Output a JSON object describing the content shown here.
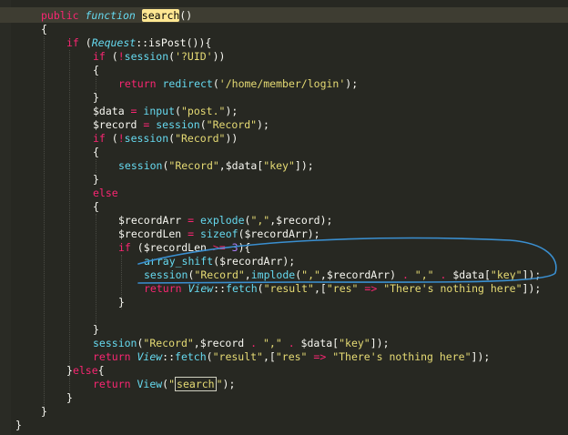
{
  "editor": {
    "lines": [
      [
        [
          "kw",
          "public "
        ],
        [
          "fn",
          "function "
        ],
        [
          "hl",
          "search"
        ],
        [
          "pl",
          "()"
        ]
      ],
      [
        [
          "pl",
          "{"
        ]
      ],
      [
        [
          "kw",
          "if "
        ],
        [
          "pl",
          "("
        ],
        [
          "cls",
          "Request"
        ],
        [
          "pl",
          "::"
        ],
        [
          "pl",
          "isPost"
        ],
        [
          "pl",
          "()){"
        ]
      ],
      [
        [
          "kw",
          "if "
        ],
        [
          "pl",
          "("
        ],
        [
          "kw",
          "!"
        ],
        [
          "call",
          "session"
        ],
        [
          "pl",
          "("
        ],
        [
          "str",
          "'?UID'"
        ],
        [
          "pl",
          "))"
        ]
      ],
      [
        [
          "pl",
          "{"
        ]
      ],
      [
        [
          "kw",
          "return "
        ],
        [
          "call",
          "redirect"
        ],
        [
          "pl",
          "("
        ],
        [
          "str",
          "'/home/member/login'"
        ],
        [
          "pl",
          ");"
        ]
      ],
      [
        [
          "pl",
          "}"
        ]
      ],
      [
        [
          "pl",
          "$data "
        ],
        [
          "kw",
          "= "
        ],
        [
          "call",
          "input"
        ],
        [
          "pl",
          "("
        ],
        [
          "str",
          "\"post.\""
        ],
        [
          "pl",
          ");"
        ]
      ],
      [
        [
          "pl",
          "$record "
        ],
        [
          "kw",
          "= "
        ],
        [
          "call",
          "session"
        ],
        [
          "pl",
          "("
        ],
        [
          "str",
          "\"Record\""
        ],
        [
          "pl",
          ");"
        ]
      ],
      [
        [
          "kw",
          "if "
        ],
        [
          "pl",
          "("
        ],
        [
          "kw",
          "!"
        ],
        [
          "call",
          "session"
        ],
        [
          "pl",
          "("
        ],
        [
          "str",
          "\"Record\""
        ],
        [
          "pl",
          "))"
        ]
      ],
      [
        [
          "pl",
          "{"
        ]
      ],
      [
        [
          "call",
          "session"
        ],
        [
          "pl",
          "("
        ],
        [
          "str",
          "\"Record\""
        ],
        [
          "pl",
          ",$data["
        ],
        [
          "str",
          "\"key\""
        ],
        [
          "pl",
          "]);"
        ]
      ],
      [
        [
          "pl",
          "}"
        ]
      ],
      [
        [
          "kw",
          "else"
        ]
      ],
      [
        [
          "pl",
          "{"
        ]
      ],
      [
        [
          "pl",
          "$recordArr "
        ],
        [
          "kw",
          "= "
        ],
        [
          "call",
          "explode"
        ],
        [
          "pl",
          "("
        ],
        [
          "str",
          "\",\""
        ],
        [
          "pl",
          ",$record);"
        ]
      ],
      [
        [
          "pl",
          "$recordLen "
        ],
        [
          "kw",
          "= "
        ],
        [
          "call",
          "sizeof"
        ],
        [
          "pl",
          "($recordArr);"
        ]
      ],
      [
        [
          "kw",
          "if "
        ],
        [
          "pl",
          "($recordLen "
        ],
        [
          "kw",
          ">= "
        ],
        [
          "num",
          "3"
        ],
        [
          "pl",
          "){"
        ]
      ],
      [
        [
          "call",
          "array_shift"
        ],
        [
          "pl",
          "($recordArr);"
        ]
      ],
      [
        [
          "call",
          "session"
        ],
        [
          "pl",
          "("
        ],
        [
          "str",
          "\"Record\""
        ],
        [
          "pl",
          ","
        ],
        [
          "call",
          "implode"
        ],
        [
          "pl",
          "("
        ],
        [
          "str",
          "\",\""
        ],
        [
          "pl",
          ",$recordArr) "
        ],
        [
          "kw",
          ". "
        ],
        [
          "str",
          "\",\""
        ],
        [
          "pl",
          " "
        ],
        [
          "kw",
          ". "
        ],
        [
          "pl",
          "$data["
        ],
        [
          "str",
          "\"key\""
        ],
        [
          "pl",
          "]);"
        ]
      ],
      [
        [
          "kw",
          "return "
        ],
        [
          "cls",
          "View"
        ],
        [
          "pl",
          "::"
        ],
        [
          "call",
          "fetch"
        ],
        [
          "pl",
          "("
        ],
        [
          "str",
          "\"result\""
        ],
        [
          "pl",
          ",["
        ],
        [
          "str",
          "\"res\""
        ],
        [
          "pl",
          " "
        ],
        [
          "kw",
          "=> "
        ],
        [
          "str",
          "\"There's nothing here\""
        ],
        [
          "pl",
          "]);"
        ]
      ],
      [
        [
          "pl",
          "}"
        ]
      ],
      [
        [
          "pl",
          ""
        ]
      ],
      [
        [
          "pl",
          "}"
        ]
      ],
      [
        [
          "call",
          "session"
        ],
        [
          "pl",
          "("
        ],
        [
          "str",
          "\"Record\""
        ],
        [
          "pl",
          ",$record "
        ],
        [
          "kw",
          ". "
        ],
        [
          "str",
          "\",\""
        ],
        [
          "pl",
          " "
        ],
        [
          "kw",
          ". "
        ],
        [
          "pl",
          "$data["
        ],
        [
          "str",
          "\"key\""
        ],
        [
          "pl",
          "]);"
        ]
      ],
      [
        [
          "kw",
          "return "
        ],
        [
          "cls",
          "View"
        ],
        [
          "pl",
          "::"
        ],
        [
          "call",
          "fetch"
        ],
        [
          "pl",
          "("
        ],
        [
          "str",
          "\"result\""
        ],
        [
          "pl",
          ",["
        ],
        [
          "str",
          "\"res\""
        ],
        [
          "pl",
          " "
        ],
        [
          "kw",
          "=> "
        ],
        [
          "str",
          "\"There's nothing here\""
        ],
        [
          "pl",
          "]);"
        ]
      ],
      [
        [
          "pl",
          "}"
        ],
        [
          "kw",
          "else"
        ],
        [
          "pl",
          "{"
        ]
      ],
      [
        [
          "kw",
          "return "
        ],
        [
          "call",
          "View"
        ],
        [
          "pl",
          "("
        ],
        [
          "str",
          "\""
        ],
        [
          "box",
          "search"
        ],
        [
          "str",
          "\""
        ],
        [
          "pl",
          ");"
        ]
      ],
      [
        [
          "pl",
          "}"
        ]
      ],
      [
        [
          "pl",
          "}"
        ]
      ],
      [
        [
          "pl",
          "}"
        ]
      ]
    ]
  }
}
